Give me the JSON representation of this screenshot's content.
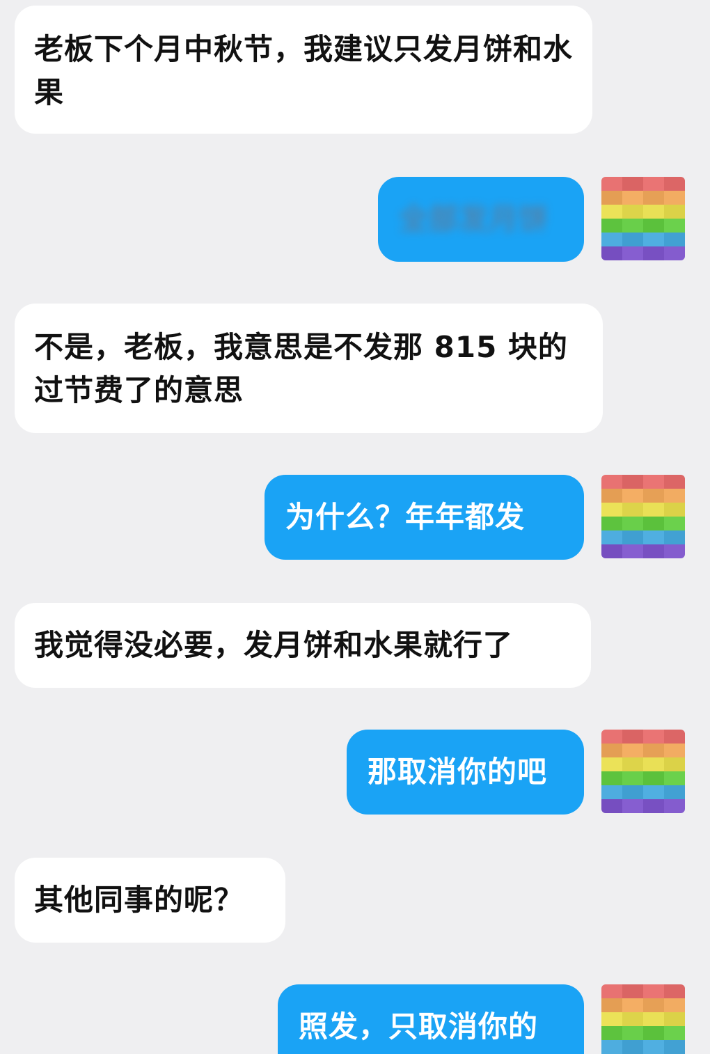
{
  "messages": [
    {
      "side": "in",
      "text": "老板下个月中秋节，我建议只发月饼和水果"
    },
    {
      "side": "out",
      "text": "全部发月饼",
      "blurred": true
    },
    {
      "side": "in",
      "text": "不是，老板，我意思是不发那 815 块的过节费了的意思"
    },
    {
      "side": "out",
      "text": "为什么？年年都发"
    },
    {
      "side": "in",
      "text": "我觉得没必要，发月饼和水果就行了"
    },
    {
      "side": "out",
      "text": "那取消你的吧"
    },
    {
      "side": "in",
      "text": "其他同事的呢？"
    },
    {
      "side": "out",
      "text": "照发，只取消你的"
    }
  ],
  "avatar": {
    "icon": "rainbow-pixel-avatar-icon",
    "colors": [
      "#e06a6a",
      "#eaa45a",
      "#e1d84e",
      "#61c742",
      "#46a5d7",
      "#7c54c6"
    ]
  },
  "colors": {
    "background": "#efeff1",
    "incoming_bubble": "#ffffff",
    "outgoing_bubble": "#1aa3f5"
  }
}
